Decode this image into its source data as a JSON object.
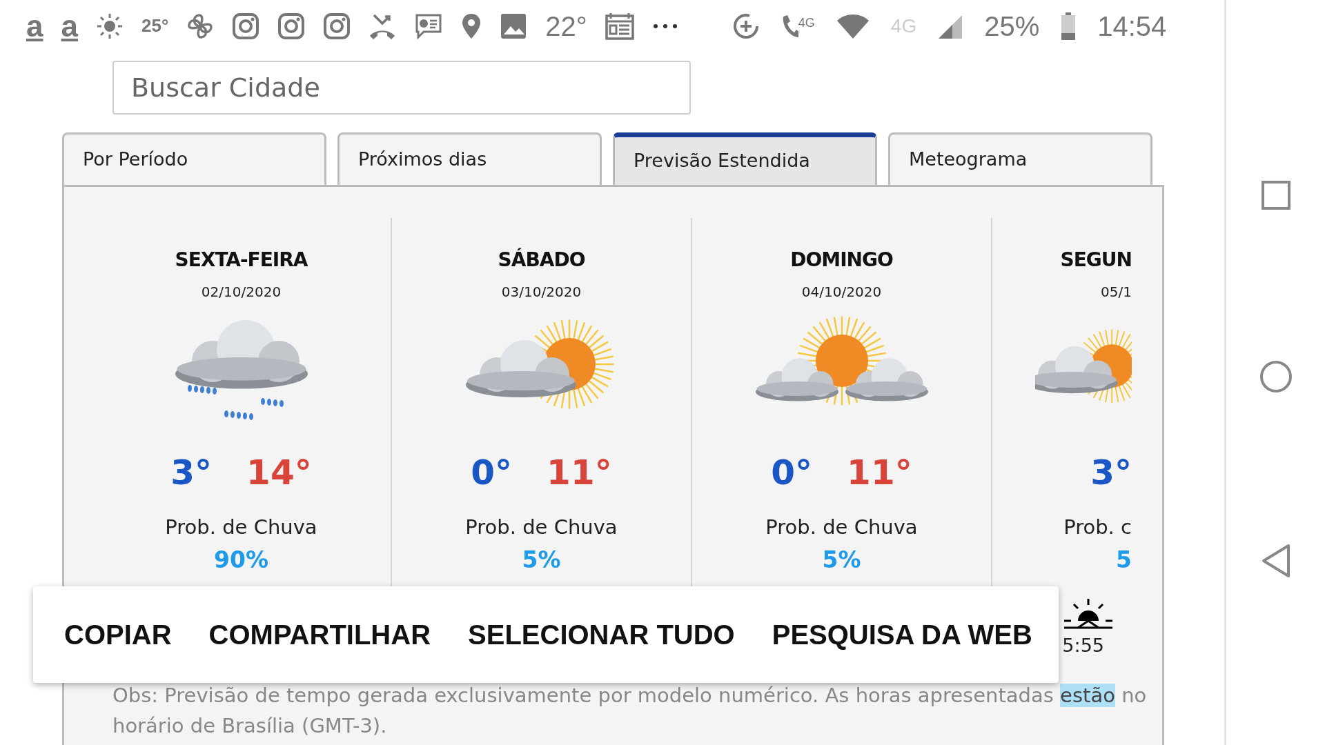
{
  "status_bar": {
    "left": [
      {
        "kind": "letter",
        "text": "a"
      },
      {
        "kind": "letter",
        "text": "a"
      },
      {
        "kind": "sun"
      },
      {
        "kind": "text",
        "text": "25°"
      },
      {
        "kind": "pinwheel"
      },
      {
        "kind": "camera"
      },
      {
        "kind": "camera"
      },
      {
        "kind": "camera"
      },
      {
        "kind": "phone_missed"
      },
      {
        "kind": "chat"
      },
      {
        "kind": "pin"
      },
      {
        "kind": "image"
      },
      {
        "kind": "big_text",
        "text": "22°"
      },
      {
        "kind": "calendar"
      },
      {
        "kind": "more"
      }
    ],
    "right": [
      {
        "kind": "data_saver"
      },
      {
        "kind": "call_tag",
        "text": "4G"
      },
      {
        "kind": "wifi"
      },
      {
        "kind": "dim_text",
        "text": "4G"
      },
      {
        "kind": "signal"
      },
      {
        "kind": "big_text",
        "text": "25%"
      },
      {
        "kind": "battery"
      },
      {
        "kind": "big_text",
        "text": "14:54"
      }
    ]
  },
  "search": {
    "placeholder": "Buscar Cidade"
  },
  "tabs": [
    {
      "label": "Por Período",
      "selected": false
    },
    {
      "label": "Próximos dias",
      "selected": false
    },
    {
      "label": "Previsão Estendida",
      "selected": true
    },
    {
      "label": "Meteograma",
      "selected": false
    }
  ],
  "days": [
    {
      "name": "SEXTA-FEIRA",
      "date": "02/10/2020",
      "kind": "rain",
      "low": "3°",
      "high": "14°",
      "rain_label": "Prob. de Chuva",
      "rain_chance": "90%"
    },
    {
      "name": "SÁBADO",
      "date": "03/10/2020",
      "kind": "sun_cloud",
      "low": "0°",
      "high": "11°",
      "rain_label": "Prob. de Chuva",
      "rain_chance": "5%"
    },
    {
      "name": "DOMINGO",
      "date": "04/10/2020",
      "kind": "sun_clouds",
      "low": "0°",
      "high": "11°",
      "rain_label": "Prob. de Chuva",
      "rain_chance": "5%"
    },
    {
      "name": "SEGUN",
      "date": "05/1",
      "kind": "sun_cloud",
      "low": "3°",
      "rain_label": "Prob. c",
      "rain_chance": "5",
      "sunrise": "5:55"
    }
  ],
  "context_menu": [
    "COPIAR",
    "COMPARTILHAR",
    "SELECIONAR TUDO",
    "PESQUISA DA WEB"
  ],
  "note": {
    "parts": [
      {
        "text": "Obs: Previsão de tempo gerada exclusivamente por modelo numérico. As horas apresentadas",
        "selected": false
      },
      {
        "text": "estão",
        "selected": true
      },
      {
        "text": "no horário de Brasília (GMT-3).",
        "selected": false
      }
    ]
  }
}
